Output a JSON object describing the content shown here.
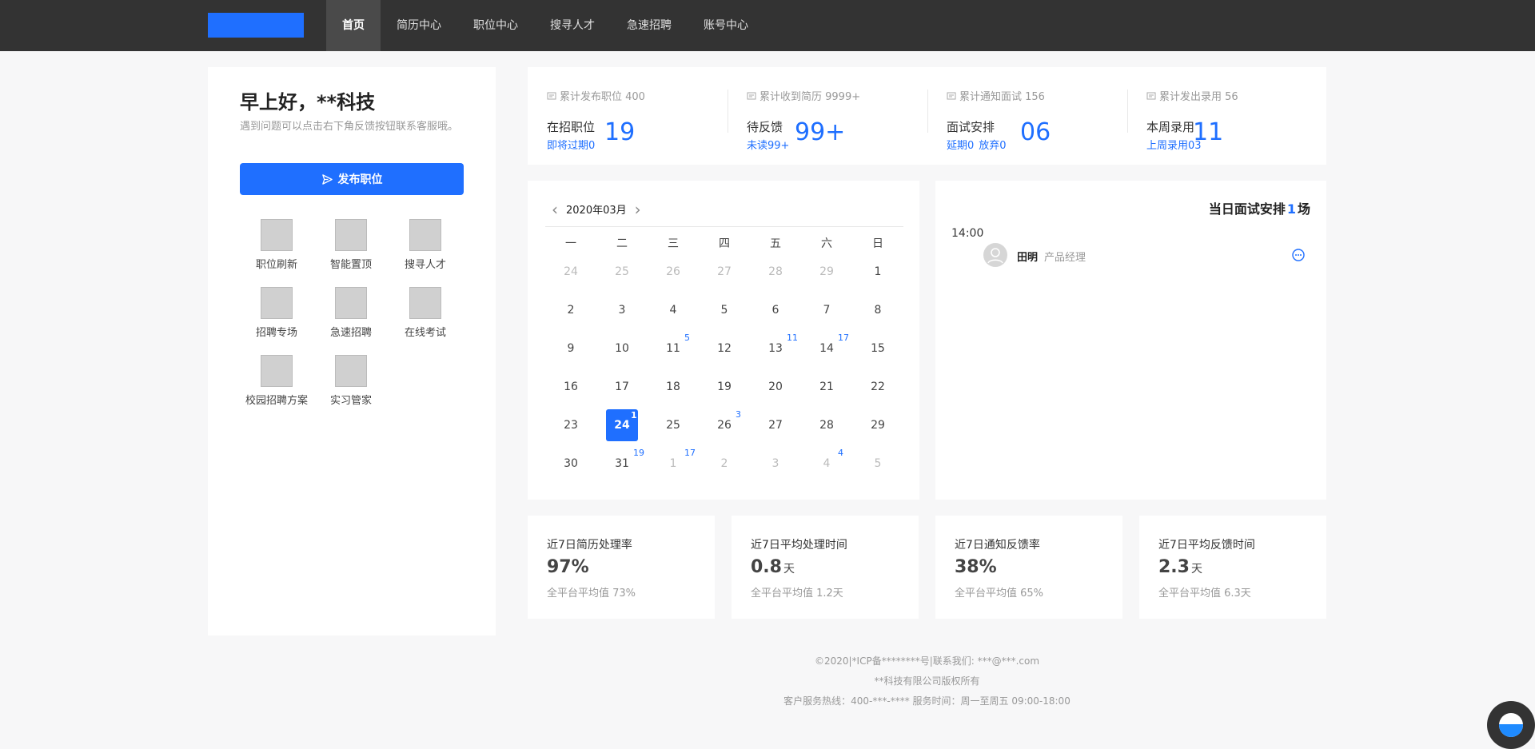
{
  "nav": {
    "items": [
      "首页",
      "简历中心",
      "职位中心",
      "搜寻人才",
      "急速招聘",
      "账号中心"
    ],
    "active_index": 0
  },
  "welcome": {
    "greeting": "早上好，**科技",
    "hint": "遇到问题可以点击右下角反馈按钮联系客服哦。",
    "publish_label": "发布职位"
  },
  "shortcuts": [
    "职位刷新",
    "智能置顶",
    "搜寻人才",
    "招聘专场",
    "急速招聘",
    "在线考试",
    "校园招聘方案",
    "实习管家"
  ],
  "stats": [
    {
      "top": "累计发布职位 400",
      "label": "在招职位",
      "subs": [
        "即将过期0"
      ],
      "value": "19"
    },
    {
      "top": "累计收到简历 9999+",
      "label": "待反馈",
      "subs": [
        "未读99+"
      ],
      "value": "99+"
    },
    {
      "top": "累计通知面试 156",
      "label": "面试安排",
      "subs": [
        "延期0",
        "放弃0"
      ],
      "value": "06"
    },
    {
      "top": "累计发出录用 56",
      "label": "本周录用",
      "subs": [
        "上周录用03"
      ],
      "value": "11"
    }
  ],
  "calendar": {
    "month_label": "2020年03月",
    "weekdays": [
      "一",
      "二",
      "三",
      "四",
      "五",
      "六",
      "日"
    ],
    "selected_day": 24,
    "days": [
      {
        "d": "24",
        "m": true
      },
      {
        "d": "25",
        "m": true
      },
      {
        "d": "26",
        "m": true
      },
      {
        "d": "27",
        "m": true
      },
      {
        "d": "28",
        "m": true
      },
      {
        "d": "29",
        "m": true
      },
      {
        "d": "1"
      },
      {
        "d": "2"
      },
      {
        "d": "3"
      },
      {
        "d": "4"
      },
      {
        "d": "5"
      },
      {
        "d": "6"
      },
      {
        "d": "7"
      },
      {
        "d": "8"
      },
      {
        "d": "9"
      },
      {
        "d": "10"
      },
      {
        "d": "11",
        "c": "5"
      },
      {
        "d": "12"
      },
      {
        "d": "13",
        "c": "11"
      },
      {
        "d": "14",
        "c": "17"
      },
      {
        "d": "15"
      },
      {
        "d": "16"
      },
      {
        "d": "17"
      },
      {
        "d": "18"
      },
      {
        "d": "19"
      },
      {
        "d": "20"
      },
      {
        "d": "21"
      },
      {
        "d": "22"
      },
      {
        "d": "23"
      },
      {
        "d": "24",
        "c": "1",
        "s": true
      },
      {
        "d": "25"
      },
      {
        "d": "26",
        "c": "3"
      },
      {
        "d": "27"
      },
      {
        "d": "28"
      },
      {
        "d": "29"
      },
      {
        "d": "30"
      },
      {
        "d": "31",
        "c": "19"
      },
      {
        "d": "1",
        "m": true,
        "c": "17"
      },
      {
        "d": "2",
        "m": true
      },
      {
        "d": "3",
        "m": true
      },
      {
        "d": "4",
        "m": true,
        "c": "4"
      },
      {
        "d": "5",
        "m": true
      }
    ]
  },
  "schedule": {
    "title_prefix": "当日面试安排",
    "count": "1",
    "title_suffix": "场",
    "time": "14:00",
    "name": "田明",
    "role": "产品经理"
  },
  "metrics": [
    {
      "title": "近7日简历处理率",
      "value": "97%",
      "unit": "",
      "avg": "全平台平均值 73%"
    },
    {
      "title": "近7日平均处理时间",
      "value": "0.8",
      "unit": "天",
      "avg": "全平台平均值 1.2天"
    },
    {
      "title": "近7日通知反馈率",
      "value": "38%",
      "unit": "",
      "avg": "全平台平均值 65%"
    },
    {
      "title": "近7日平均反馈时间",
      "value": "2.3",
      "unit": "天",
      "avg": "全平台平均值 6.3天"
    }
  ],
  "footer": {
    "line1": "©2020|*ICP备********号|联系我们: ***@***.com",
    "line2": "**科技有限公司版权所有",
    "line3": "客户服务热线：400-***-**** 服务时间：周一至周五 09:00-18:00"
  },
  "colors": {
    "accent": "#1f6fff",
    "topbar": "#333333"
  }
}
